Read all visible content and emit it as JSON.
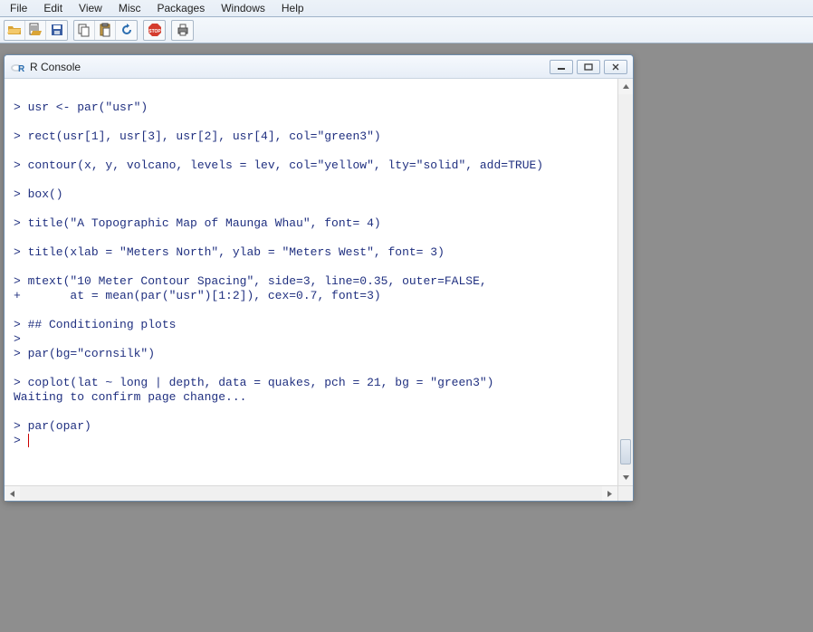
{
  "menu": {
    "items": [
      "File",
      "Edit",
      "View",
      "Misc",
      "Packages",
      "Windows",
      "Help"
    ]
  },
  "toolbar": {
    "groups": [
      [
        "open-icon",
        "load-workspace-icon",
        "save-icon"
      ],
      [
        "copy-icon",
        "paste-icon",
        "refresh-icon"
      ],
      [
        "stop-icon"
      ],
      [
        "print-icon"
      ]
    ]
  },
  "console": {
    "title": "R Console",
    "lines": [
      "",
      "> usr <- par(\"usr\")",
      "",
      "> rect(usr[1], usr[3], usr[2], usr[4], col=\"green3\")",
      "",
      "> contour(x, y, volcano, levels = lev, col=\"yellow\", lty=\"solid\", add=TRUE)",
      "",
      "> box()",
      "",
      "> title(\"A Topographic Map of Maunga Whau\", font= 4)",
      "",
      "> title(xlab = \"Meters North\", ylab = \"Meters West\", font= 3)",
      "",
      "> mtext(\"10 Meter Contour Spacing\", side=3, line=0.35, outer=FALSE,",
      "+       at = mean(par(\"usr\")[1:2]), cex=0.7, font=3)",
      "",
      "> ## Conditioning plots",
      ">",
      "> par(bg=\"cornsilk\")",
      "",
      "> coplot(lat ~ long | depth, data = quakes, pch = 21, bg = \"green3\")",
      "Waiting to confirm page change...",
      "",
      "> par(opar)",
      "> "
    ]
  }
}
